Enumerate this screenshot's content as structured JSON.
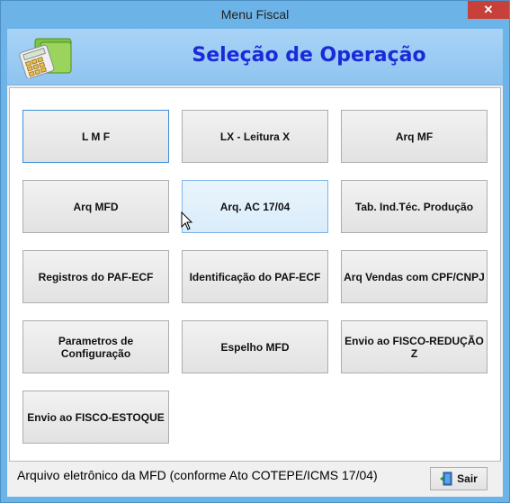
{
  "window": {
    "title": "Menu Fiscal",
    "close_label": "✕"
  },
  "header": {
    "title": "Seleção de Operação",
    "icon": "calculator-folder-icon"
  },
  "buttons": [
    "L M F",
    "LX - Leitura X",
    "Arq MF",
    "Arq MFD",
    "Arq. AC 17/04",
    "Tab. Ind.Téc. Produção",
    "Registros do PAF-ECF",
    "Identificação do PAF-ECF",
    "Arq Vendas com CPF/CNPJ",
    "Parametros de Configuração",
    "Espelho MFD",
    "Envio ao FISCO-REDUÇÃO Z",
    "Envio ao FISCO-ESTOQUE"
  ],
  "status": {
    "text": "Arquivo eletrônico da MFD (conforme Ato COTEPE/ICMS 17/04)"
  },
  "footer": {
    "exit_label": "Sair",
    "exit_icon": "exit-door-icon"
  },
  "colors": {
    "title_blue": "#1a2ad8",
    "header_bg": "#a9d3f6",
    "frame": "#6cb3e8",
    "close_red": "#c7413a"
  }
}
